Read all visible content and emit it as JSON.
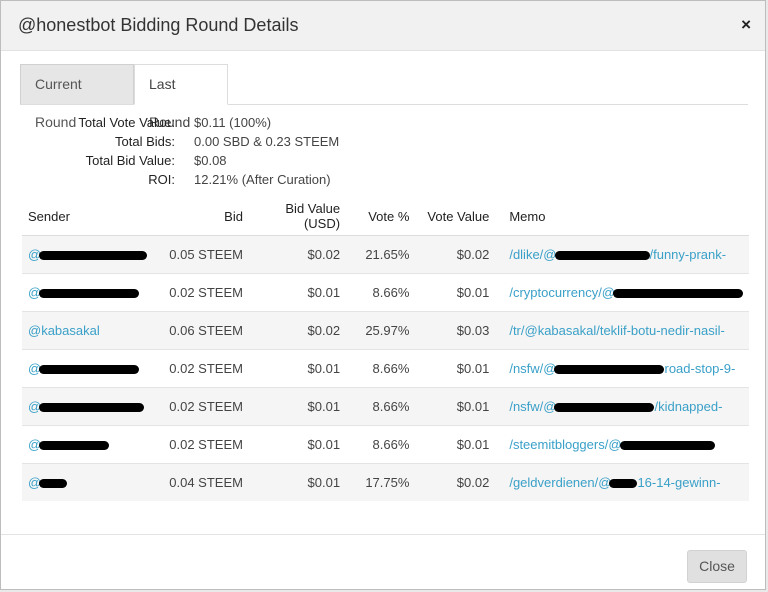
{
  "modal": {
    "title": "@honestbot Bidding Round Details",
    "close_symbol": "×",
    "close_button": "Close"
  },
  "tabs": [
    {
      "label": "Current Round",
      "active": false
    },
    {
      "label": "Last Round",
      "active": true
    }
  ],
  "summary": [
    {
      "label": "Total Vote Value:",
      "value": "$0.11 (100%)"
    },
    {
      "label": "Total Bids:",
      "value": "0.00 SBD & 0.23 STEEM"
    },
    {
      "label": "Total Bid Value:",
      "value": "$0.08"
    },
    {
      "label": "ROI:",
      "value": "12.21% (After Curation)"
    }
  ],
  "table": {
    "headers": [
      "Sender",
      "Bid",
      "Bid Value (USD)",
      "Vote %",
      "Vote Value",
      "Memo"
    ],
    "rows": [
      {
        "sender": "@",
        "bid": "0.05 STEEM",
        "bid_value": "$0.02",
        "vote_pct": "21.65%",
        "vote_value": "$0.02",
        "memo": "/dlike/@",
        "memo_tail": "/funny-prank-"
      },
      {
        "sender": "@",
        "bid": "0.02 STEEM",
        "bid_value": "$0.01",
        "vote_pct": "8.66%",
        "vote_value": "$0.01",
        "memo": "/cryptocurrency/@",
        "memo_tail": ""
      },
      {
        "sender": "@kabasakal",
        "bid": "0.06 STEEM",
        "bid_value": "$0.02",
        "vote_pct": "25.97%",
        "vote_value": "$0.03",
        "memo": "/tr/@kabasakal/teklif-botu-nedir-nasil-",
        "memo_tail": ""
      },
      {
        "sender": "@",
        "bid": "0.02 STEEM",
        "bid_value": "$0.01",
        "vote_pct": "8.66%",
        "vote_value": "$0.01",
        "memo": "/nsfw/@",
        "memo_tail": "road-stop-9-"
      },
      {
        "sender": "@",
        "bid": "0.02 STEEM",
        "bid_value": "$0.01",
        "vote_pct": "8.66%",
        "vote_value": "$0.01",
        "memo": "/nsfw/@",
        "memo_tail": "/kidnapped-"
      },
      {
        "sender": "@",
        "bid": "0.02 STEEM",
        "bid_value": "$0.01",
        "vote_pct": "8.66%",
        "vote_value": "$0.01",
        "memo": "/steemitbloggers/@",
        "memo_tail": ""
      },
      {
        "sender": "@",
        "bid": "0.04 STEEM",
        "bid_value": "$0.01",
        "vote_pct": "17.75%",
        "vote_value": "$0.02",
        "memo": "/geldverdienen/@",
        "memo_tail": "16-14-gewinn-"
      }
    ]
  },
  "colors": {
    "link": "#3aa0c8",
    "header_bg": "#f1f1f1",
    "stripe": "#f5f5f5"
  }
}
